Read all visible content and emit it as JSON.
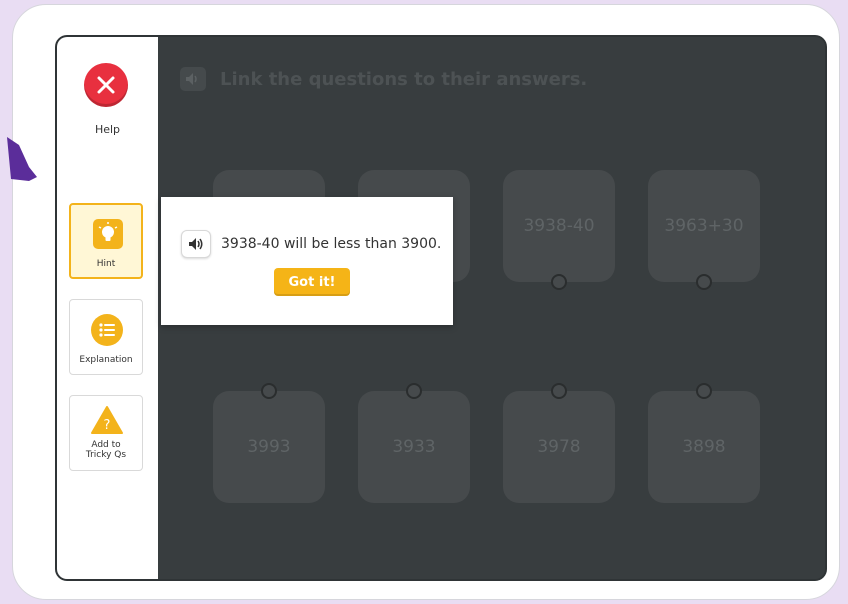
{
  "sidebar": {
    "help_label": "Help",
    "hint_label": "Hint",
    "explanation_label": "Explanation",
    "tricky_label_line1": "Add to",
    "tricky_label_line2": "Tricky Qs"
  },
  "instruction": "Link the questions to their answers.",
  "question_tiles": [
    "",
    "",
    "3938-40",
    "3963+30"
  ],
  "answer_tiles": [
    "3993",
    "3933",
    "3978",
    "3898"
  ],
  "hint_modal": {
    "text": "3938-40 will be less than 3900.",
    "button_label": "Got it!"
  },
  "colors": {
    "accent": "#f3b31b",
    "help_red": "#e8303f",
    "page_bg": "#e9ddf3",
    "arrow_purple": "#5b2d9a"
  }
}
